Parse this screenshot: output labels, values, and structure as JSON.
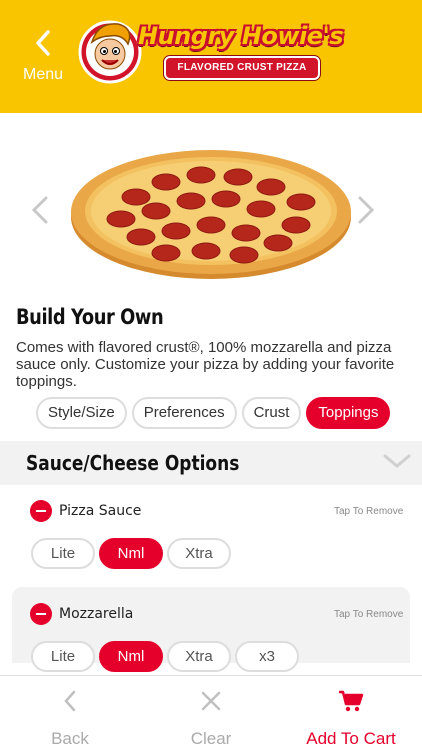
{
  "header": {
    "menu_label": "Menu",
    "logo_text": "Hungry Howie's",
    "logo_tagline": "FLAVORED CRUST PIZZA"
  },
  "product": {
    "title": "Build Your Own",
    "description": "Comes with flavored crust®, 100% mozzarella and pizza sauce only. Customize your pizza by adding your favorite toppings."
  },
  "tabs": [
    {
      "label": "Style/Size",
      "active": false
    },
    {
      "label": "Preferences",
      "active": false
    },
    {
      "label": "Crust",
      "active": false
    },
    {
      "label": "Toppings",
      "active": true
    }
  ],
  "section": {
    "title": "Sauce/Cheese Options"
  },
  "options": [
    {
      "name": "Pizza Sauce",
      "remove_label": "Tap To Remove",
      "amounts": [
        "Lite",
        "Nml",
        "Xtra"
      ],
      "selected": "Nml"
    },
    {
      "name": "Mozzarella",
      "remove_label": "Tap To Remove",
      "amounts": [
        "Lite",
        "Nml",
        "Xtra",
        "x3"
      ],
      "selected": "Nml"
    }
  ],
  "bottom_bar": {
    "back_label": "Back",
    "clear_label": "Clear",
    "cart_label": "Add To Cart"
  },
  "colors": {
    "brand_yellow": "#f9c400",
    "accent_red": "#e4002b"
  }
}
